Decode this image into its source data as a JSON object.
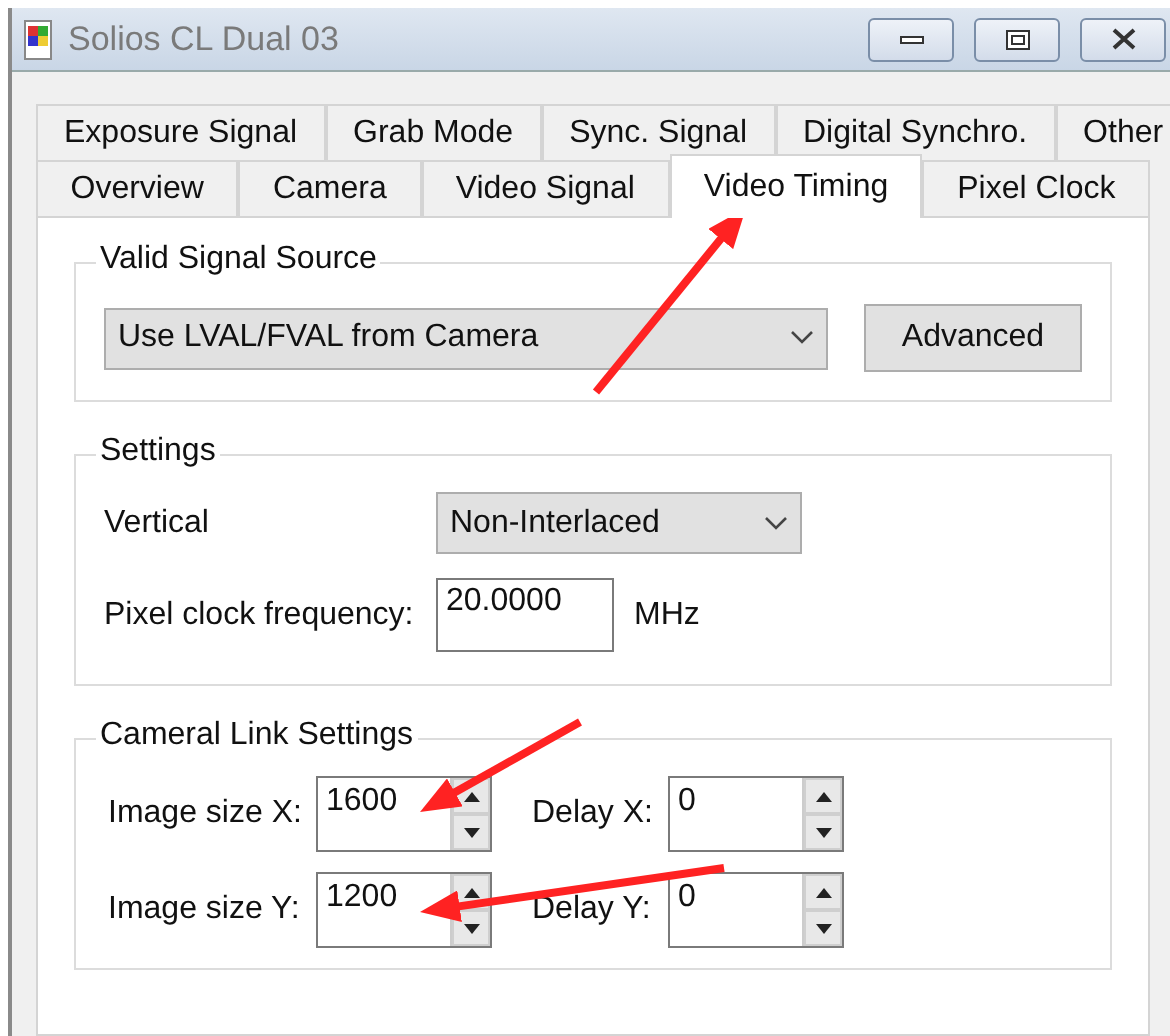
{
  "window": {
    "title": "Solios CL Dual 03"
  },
  "tab_rows": [
    [
      {
        "label": "Exposure Signal",
        "selected": false
      },
      {
        "label": "Grab Mode",
        "selected": false
      },
      {
        "label": "Sync. Signal",
        "selected": false
      },
      {
        "label": "Digital Synchro.",
        "selected": false
      },
      {
        "label": "Other",
        "selected": false
      }
    ],
    [
      {
        "label": "Overview",
        "selected": false
      },
      {
        "label": "Camera",
        "selected": false
      },
      {
        "label": "Video Signal",
        "selected": false
      },
      {
        "label": "Video Timing",
        "selected": true
      },
      {
        "label": "Pixel Clock",
        "selected": false
      }
    ]
  ],
  "valid_signal_source": {
    "title": "Valid Signal Source",
    "source": "Use LVAL/FVAL from Camera",
    "button": "Advanced"
  },
  "settings": {
    "title": "Settings",
    "vertical_label": "Vertical",
    "vertical": "Non-Interlaced",
    "frequency_label": "Pixel clock frequency:",
    "frequency": "20.0000",
    "unit": "MHz"
  },
  "camera_link": {
    "title": "Cameral Link Settings",
    "rows": [
      {
        "size_label": "Image size X:",
        "size": "1600",
        "delay_label": "Delay X:",
        "delay": "0"
      },
      {
        "size_label": "Image size Y:",
        "size": "1200",
        "delay_label": "Delay Y:",
        "delay": "0"
      }
    ]
  },
  "annotations": [
    {
      "kind": "arrow"
    },
    {
      "kind": "arrow"
    },
    {
      "kind": "arrow"
    }
  ]
}
